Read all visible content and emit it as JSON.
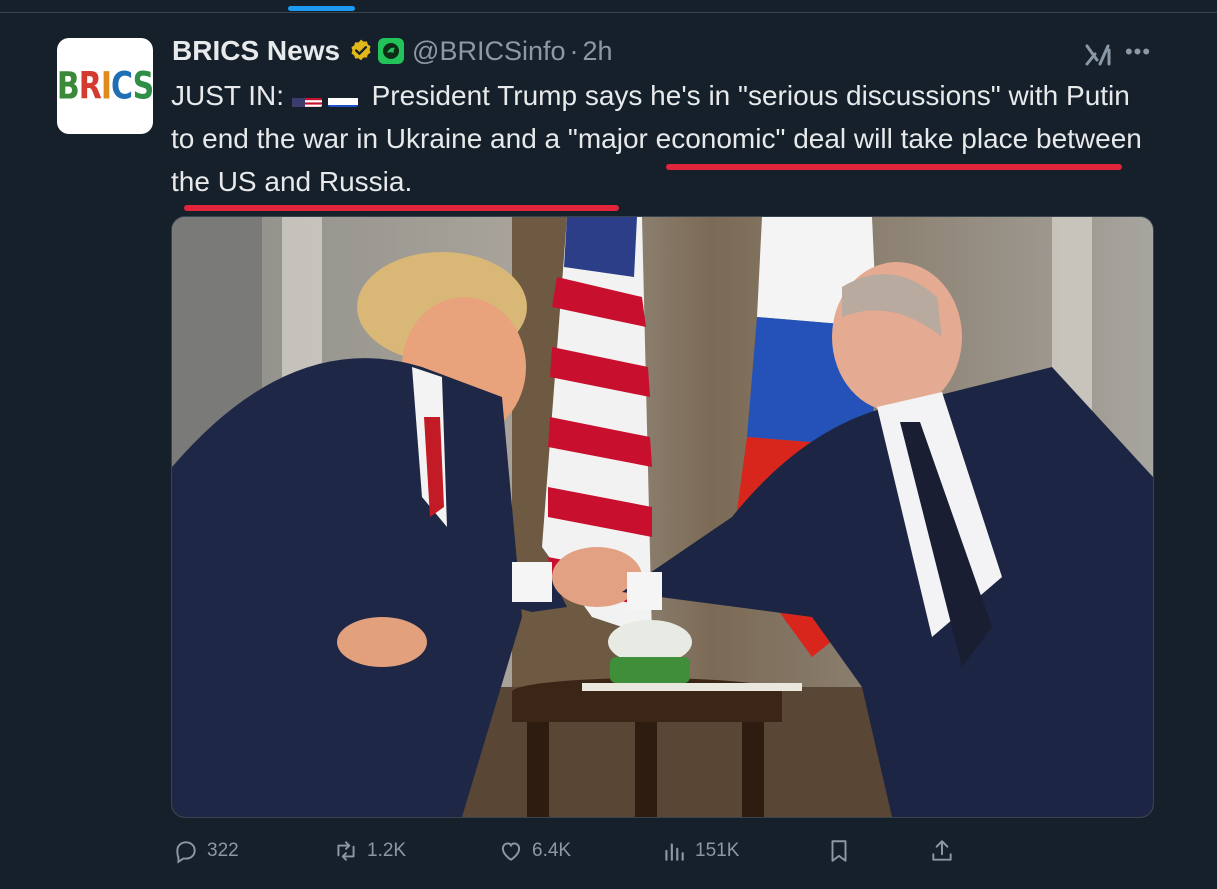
{
  "account": {
    "display_name": "BRICS News",
    "handle": "@BRICSinfo",
    "separator": "·",
    "time": "2h",
    "avatar_text": "BRICS"
  },
  "tweet": {
    "prefix": "JUST IN:",
    "flags": [
      "us-flag",
      "russia-flag"
    ],
    "body": "President Trump says he's in \"serious discussions\" with Putin to end the war in Ukraine and a \"major economic\" deal will take place between the US and Russia."
  },
  "actions": {
    "replies": "322",
    "reposts": "1.2K",
    "likes": "6.4K",
    "views": "151K"
  },
  "icons": {
    "verified": "verified-badge-icon",
    "affiliate": "affiliate-badge-icon",
    "grok": "grok-icon",
    "more": "more-icon",
    "reply": "reply-icon",
    "repost": "repost-icon",
    "like": "heart-icon",
    "views": "views-icon",
    "bookmark": "bookmark-icon",
    "share": "share-icon"
  },
  "colors": {
    "background": "#15202b",
    "text": "#e7e9ea",
    "muted": "#8b98a5",
    "accent": "#1d9bf0",
    "highlight_underline": "#e0243a",
    "verified_gold": "#e2b719"
  }
}
